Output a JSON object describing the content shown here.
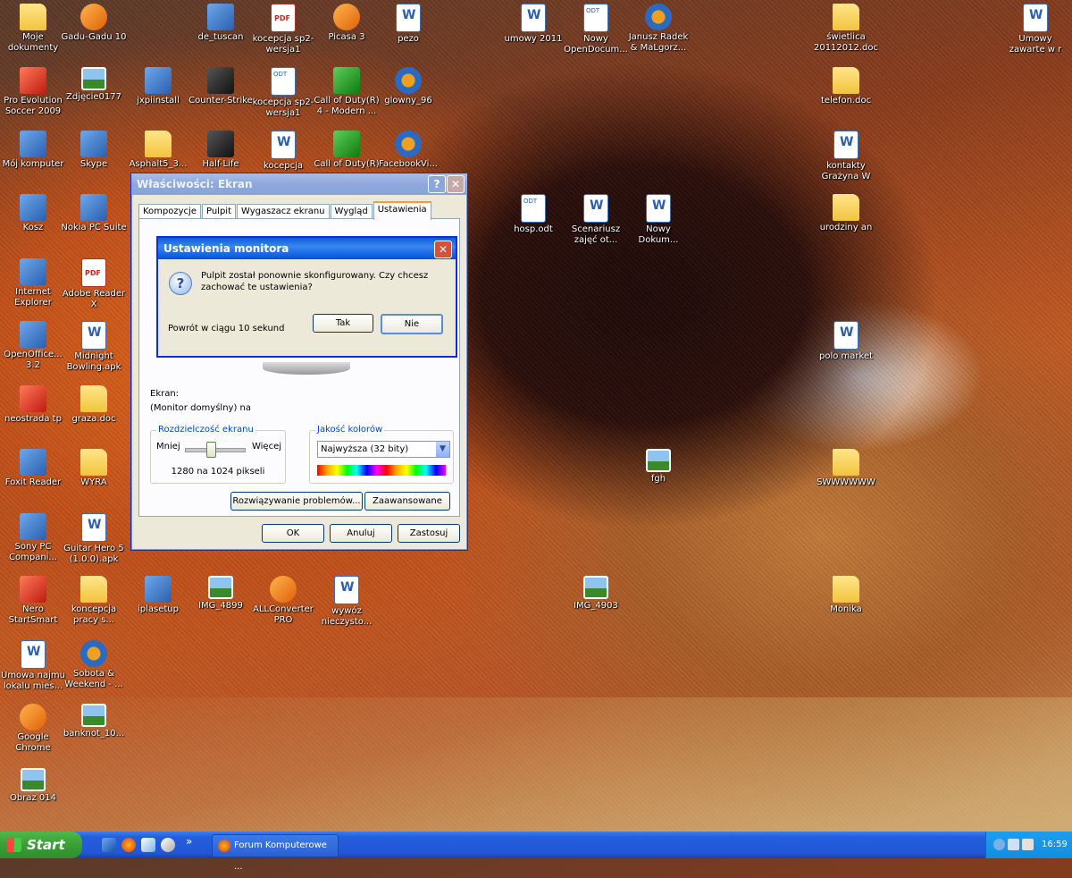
{
  "desktop_icons": [
    {
      "label": "Moje dokumenty",
      "icon": "my-documents-icon",
      "kind": "folder"
    },
    {
      "label": "Gadu-Gadu 10",
      "icon": "gadu-gadu-icon",
      "kind": "orange"
    },
    {
      "label": "de_tuscan",
      "icon": "winrar-archive-icon",
      "kind": "app"
    },
    {
      "label": "kocepcja sp2-wersja1",
      "icon": "pdf-file-icon",
      "kind": "pdf"
    },
    {
      "label": "Picasa 3",
      "icon": "picasa-icon",
      "kind": "orange"
    },
    {
      "label": "pezo",
      "icon": "word-document-icon",
      "kind": "doc"
    },
    {
      "label": "umowy 2011",
      "icon": "word-document-icon",
      "kind": "doc"
    },
    {
      "label": "Nowy OpenDocum...",
      "icon": "odt-file-icon",
      "kind": "odt"
    },
    {
      "label": "Janusz Radek & MaLgorz...",
      "icon": "media-file-icon",
      "kind": "media"
    },
    {
      "label": "świetlica 20112012.doc",
      "icon": "folder-icon",
      "kind": "folder"
    },
    {
      "label": "Umowy zawarte w r",
      "icon": "word-document-icon",
      "kind": "doc"
    },
    {
      "label": "Pro Evolution Soccer 2009",
      "icon": "game-icon",
      "kind": "red"
    },
    {
      "label": "Zdjęcie0177",
      "icon": "image-file-icon",
      "kind": "img"
    },
    {
      "label": "jxpiinstall",
      "icon": "java-icon",
      "kind": "app"
    },
    {
      "label": "Counter-Strike",
      "icon": "game-icon",
      "kind": "dark"
    },
    {
      "label": "kocepcja sp2-wersja1",
      "icon": "odt-file-icon",
      "kind": "odt"
    },
    {
      "label": "Call of Duty(R) 4 - Modern ...",
      "icon": "game-icon",
      "kind": "green"
    },
    {
      "label": "glowny_96",
      "icon": "media-file-icon",
      "kind": "media"
    },
    {
      "label": "telefon.doc",
      "icon": "folder-icon",
      "kind": "folder"
    },
    {
      "label": "Mój komputer",
      "icon": "my-computer-icon",
      "kind": "app"
    },
    {
      "label": "Skype",
      "icon": "skype-icon",
      "kind": "app"
    },
    {
      "label": "Asphalt5_3...",
      "icon": "folder-icon",
      "kind": "folder"
    },
    {
      "label": "Half-Life",
      "icon": "half-life-icon",
      "kind": "dark"
    },
    {
      "label": "kocepcja",
      "icon": "word-document-icon",
      "kind": "doc"
    },
    {
      "label": "Call of Duty(R)",
      "icon": "game-icon",
      "kind": "green"
    },
    {
      "label": "FacebookVi...",
      "icon": "media-file-icon",
      "kind": "media"
    },
    {
      "label": "kontakty Grażyna W",
      "icon": "text-file-icon",
      "kind": "doc"
    },
    {
      "label": "Kosz",
      "icon": "recycle-bin-icon",
      "kind": "app"
    },
    {
      "label": "Nokia PC Suite",
      "icon": "nokia-pc-suite-icon",
      "kind": "app"
    },
    {
      "label": "hosp.odt",
      "icon": "odt-file-icon",
      "kind": "odt"
    },
    {
      "label": "Scenariusz zajęć ot...",
      "icon": "word-document-icon",
      "kind": "doc"
    },
    {
      "label": "Nowy Dokum...",
      "icon": "word-document-icon",
      "kind": "doc"
    },
    {
      "label": "urodziny an",
      "icon": "folder-icon",
      "kind": "folder"
    },
    {
      "label": "Internet Explorer",
      "icon": "internet-explorer-icon",
      "kind": "app"
    },
    {
      "label": "Adobe Reader X",
      "icon": "adobe-reader-icon",
      "kind": "pdf"
    },
    {
      "label": "OpenOffice... 3.2",
      "icon": "openoffice-icon",
      "kind": "app"
    },
    {
      "label": "Midnight Bowling.apk",
      "icon": "apk-file-icon",
      "kind": "doc"
    },
    {
      "label": "polo market",
      "icon": "word-document-icon",
      "kind": "doc"
    },
    {
      "label": "neostrada tp",
      "icon": "neostrada-icon",
      "kind": "red"
    },
    {
      "label": "graza.doc",
      "icon": "folder-icon",
      "kind": "folder"
    },
    {
      "label": "Foxit Reader",
      "icon": "foxit-reader-icon",
      "kind": "app"
    },
    {
      "label": "WYRA",
      "icon": "folder-icon",
      "kind": "folder"
    },
    {
      "label": "fgh",
      "icon": "image-file-icon",
      "kind": "img"
    },
    {
      "label": "SWWWWWW",
      "icon": "folder-icon",
      "kind": "folder"
    },
    {
      "label": "Sony PC Compani...",
      "icon": "sony-pc-companion-icon",
      "kind": "app"
    },
    {
      "label": "Guitar Hero 5 (1.0.0).apk",
      "icon": "apk-file-icon",
      "kind": "doc"
    },
    {
      "label": "Nero StartSmart",
      "icon": "nero-icon",
      "kind": "red"
    },
    {
      "label": "koncepcja pracy s...",
      "icon": "folder-icon",
      "kind": "folder"
    },
    {
      "label": "iplasetup",
      "icon": "setup-icon",
      "kind": "app"
    },
    {
      "label": "IMG_4899",
      "icon": "image-file-icon",
      "kind": "img"
    },
    {
      "label": "ALLConverter PRO",
      "icon": "allconverter-icon",
      "kind": "orange"
    },
    {
      "label": "wywóz nieczysto...",
      "icon": "word-document-icon",
      "kind": "doc"
    },
    {
      "label": "IMG_4903",
      "icon": "image-file-icon",
      "kind": "img"
    },
    {
      "label": "Monika",
      "icon": "folder-icon",
      "kind": "folder"
    },
    {
      "label": "Umowa najmu lokalu mies...",
      "icon": "document-icon",
      "kind": "doc"
    },
    {
      "label": "Sobota & Weekend - ...",
      "icon": "media-file-icon",
      "kind": "media"
    },
    {
      "label": "Google Chrome",
      "icon": "chrome-icon",
      "kind": "orange"
    },
    {
      "label": "banknot_10...",
      "icon": "image-file-icon",
      "kind": "img"
    },
    {
      "label": "Obraz 014",
      "icon": "image-file-icon",
      "kind": "img"
    }
  ],
  "properties_window": {
    "title": "Właściwości: Ekran",
    "help_label": "?",
    "close_label": "✕",
    "tabs": [
      "Kompozycje",
      "Pulpit",
      "Wygaszacz ekranu",
      "Wygląd",
      "Ustawienia"
    ],
    "active_tab": "Ustawienia",
    "screen_label": "Ekran:",
    "screen_value": "(Monitor domyślny) na",
    "resolution_group": "Rozdzielczość ekranu",
    "less_label": "Mniej",
    "more_label": "Więcej",
    "resolution_value": "1280 na 1024 pikseli",
    "color_group": "Jakość kolorów",
    "color_value": "Najwyższa (32 bity)",
    "troubleshoot_button": "Rozwiązywanie problemów...",
    "advanced_button": "Zaawansowane",
    "ok_button": "OK",
    "cancel_button": "Anuluj",
    "apply_button": "Zastosuj"
  },
  "monitor_dialog": {
    "title": "Ustawienia monitora",
    "close_label": "✕",
    "message": "Pulpit został ponownie skonfigurowany. Czy chcesz zachować te ustawienia?",
    "countdown": "Powrót w ciągu 10 sekund",
    "yes_button": "Tak",
    "no_button": "Nie"
  },
  "taskbar": {
    "start_label": "Start",
    "task_label": "Forum Komputerowe ...",
    "overflow": "»",
    "clock": "16:59"
  }
}
